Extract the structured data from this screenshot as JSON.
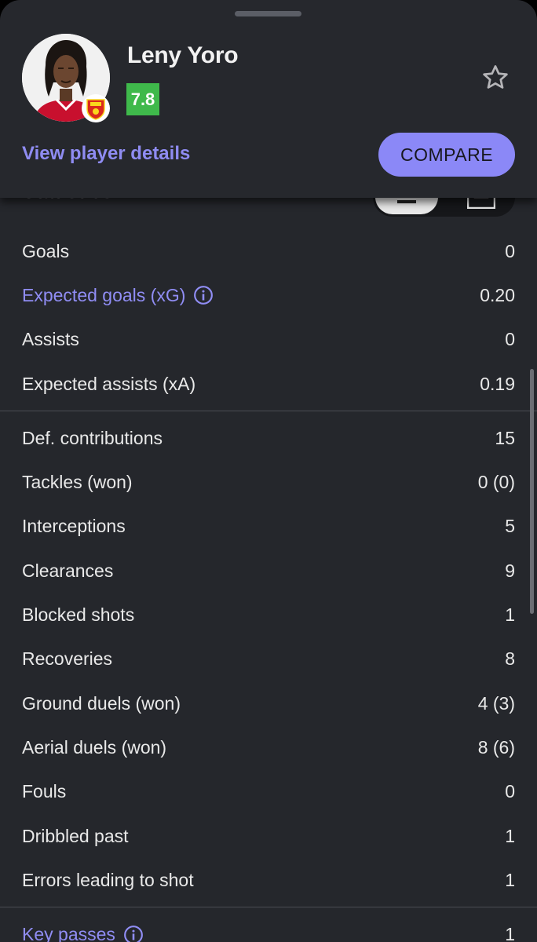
{
  "player": {
    "name": "Leny Yoro",
    "rating": "7.8",
    "details_link": "View player details",
    "compare_label": "COMPARE",
    "club_badge_icon": "man-utd-crest-icon"
  },
  "section_title": "Statistics",
  "colors": {
    "accent": "#8b88f7",
    "rating_green": "#3fb94b",
    "background": "#25272c"
  },
  "group1": [
    {
      "label": "Goals",
      "value": "0"
    },
    {
      "label": "Expected goals (xG)",
      "value": "0.20",
      "link": true
    },
    {
      "label": "Assists",
      "value": "0"
    },
    {
      "label": "Expected assists (xA)",
      "value": "0.19"
    }
  ],
  "group2": [
    {
      "label": "Def. contributions",
      "value": "15"
    },
    {
      "label": "Tackles (won)",
      "value": "0 (0)"
    },
    {
      "label": "Interceptions",
      "value": "5"
    },
    {
      "label": "Clearances",
      "value": "9"
    },
    {
      "label": "Blocked shots",
      "value": "1"
    },
    {
      "label": "Recoveries",
      "value": "8"
    },
    {
      "label": "Ground duels (won)",
      "value": "4 (3)"
    },
    {
      "label": "Aerial duels (won)",
      "value": "8 (6)"
    },
    {
      "label": "Fouls",
      "value": "0"
    },
    {
      "label": "Dribbled past",
      "value": "1"
    },
    {
      "label": "Errors leading to shot",
      "value": "1"
    }
  ],
  "group3": [
    {
      "label": "Key passes",
      "value": "1",
      "link": true
    }
  ]
}
